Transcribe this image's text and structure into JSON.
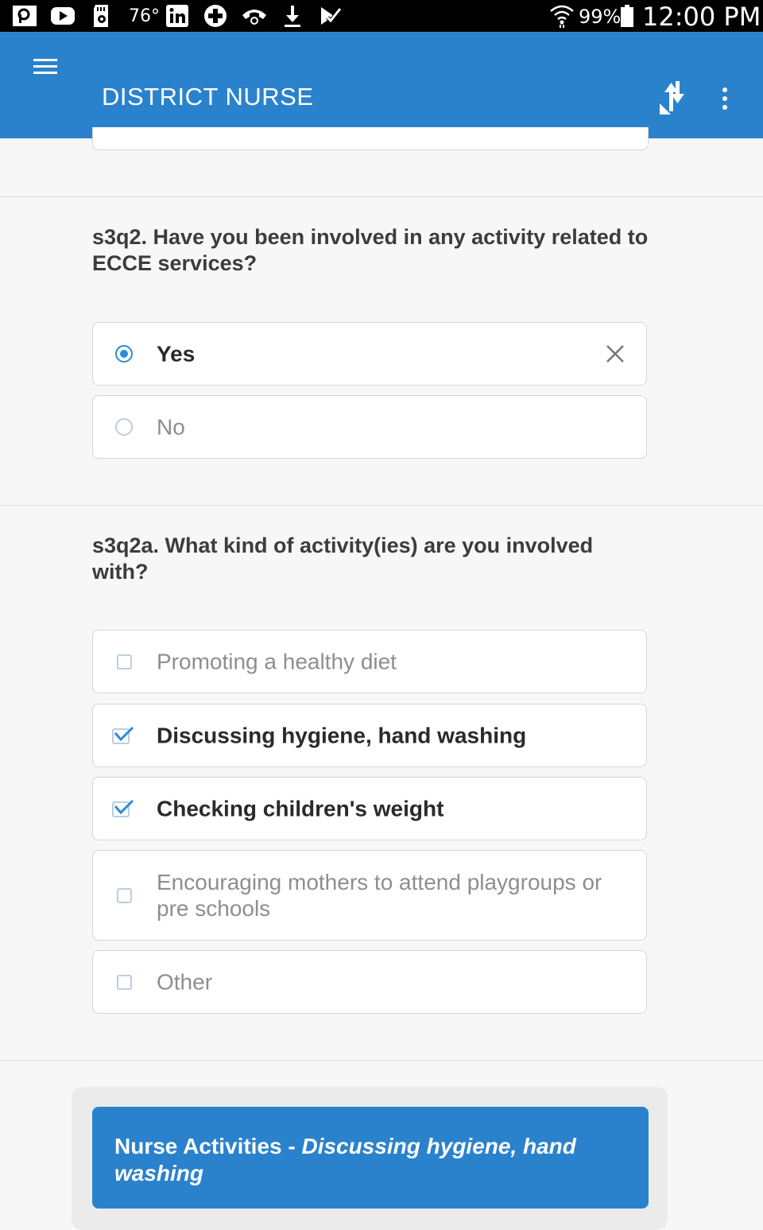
{
  "status_bar": {
    "temperature": "76°",
    "battery": "99%",
    "time": "12:00 PM"
  },
  "app_bar": {
    "title": "DISTRICT NURSE",
    "icons": [
      "menu-icon",
      "sync-icon",
      "more-vertical-icon"
    ]
  },
  "colors": {
    "primary": "#2a82cc",
    "accent": "#2a8bd8",
    "background": "#f7f7f7"
  },
  "q1": {
    "label": "s3q2. Have you been involved in any activity related to ECCE services?",
    "options": [
      {
        "label": "Yes",
        "selected": true
      },
      {
        "label": "No",
        "selected": false
      }
    ]
  },
  "q2": {
    "label": "s3q2a. What kind of activity(ies) are you involved with?",
    "options": [
      {
        "label": "Promoting a healthy diet",
        "checked": false
      },
      {
        "label": "Discussing hygiene, hand washing",
        "checked": true
      },
      {
        "label": "Checking children's weight",
        "checked": true
      },
      {
        "label": "Encouraging mothers to attend playgroups or pre schools",
        "checked": false
      },
      {
        "label": "Other",
        "checked": false
      }
    ]
  },
  "footer": {
    "prefix": "Nurse Activities - ",
    "value": "Discussing hygiene, hand washing"
  }
}
